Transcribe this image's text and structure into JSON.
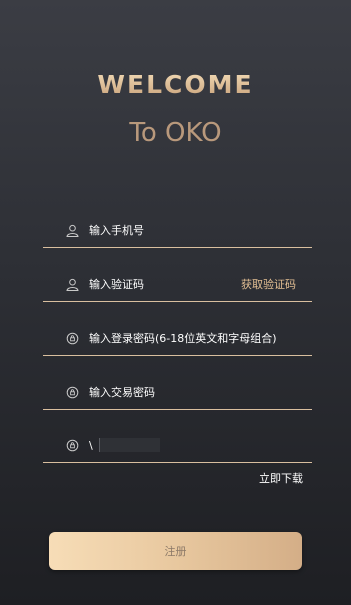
{
  "header": {
    "welcome": "WELCOME",
    "subtitle": "To OKO"
  },
  "form": {
    "phone": {
      "placeholder": "输入手机号",
      "icon": "user-icon"
    },
    "code": {
      "placeholder": "输入验证码",
      "icon": "user-icon",
      "action": "获取验证码"
    },
    "login_password": {
      "placeholder": "输入登录密码(6-18位英文和字母组合)",
      "icon": "lock-icon"
    },
    "trade_password": {
      "placeholder": "输入交易密码",
      "icon": "lock-icon"
    },
    "invite": {
      "value": "\\",
      "icon": "lock-icon"
    }
  },
  "download_link": "立即下载",
  "register_button": "注册",
  "colors": {
    "accent": "#e3bf93",
    "underline": "#d9bf9f",
    "button_gradient_start": "#f7ddb7",
    "button_gradient_end": "#d4ae87"
  }
}
